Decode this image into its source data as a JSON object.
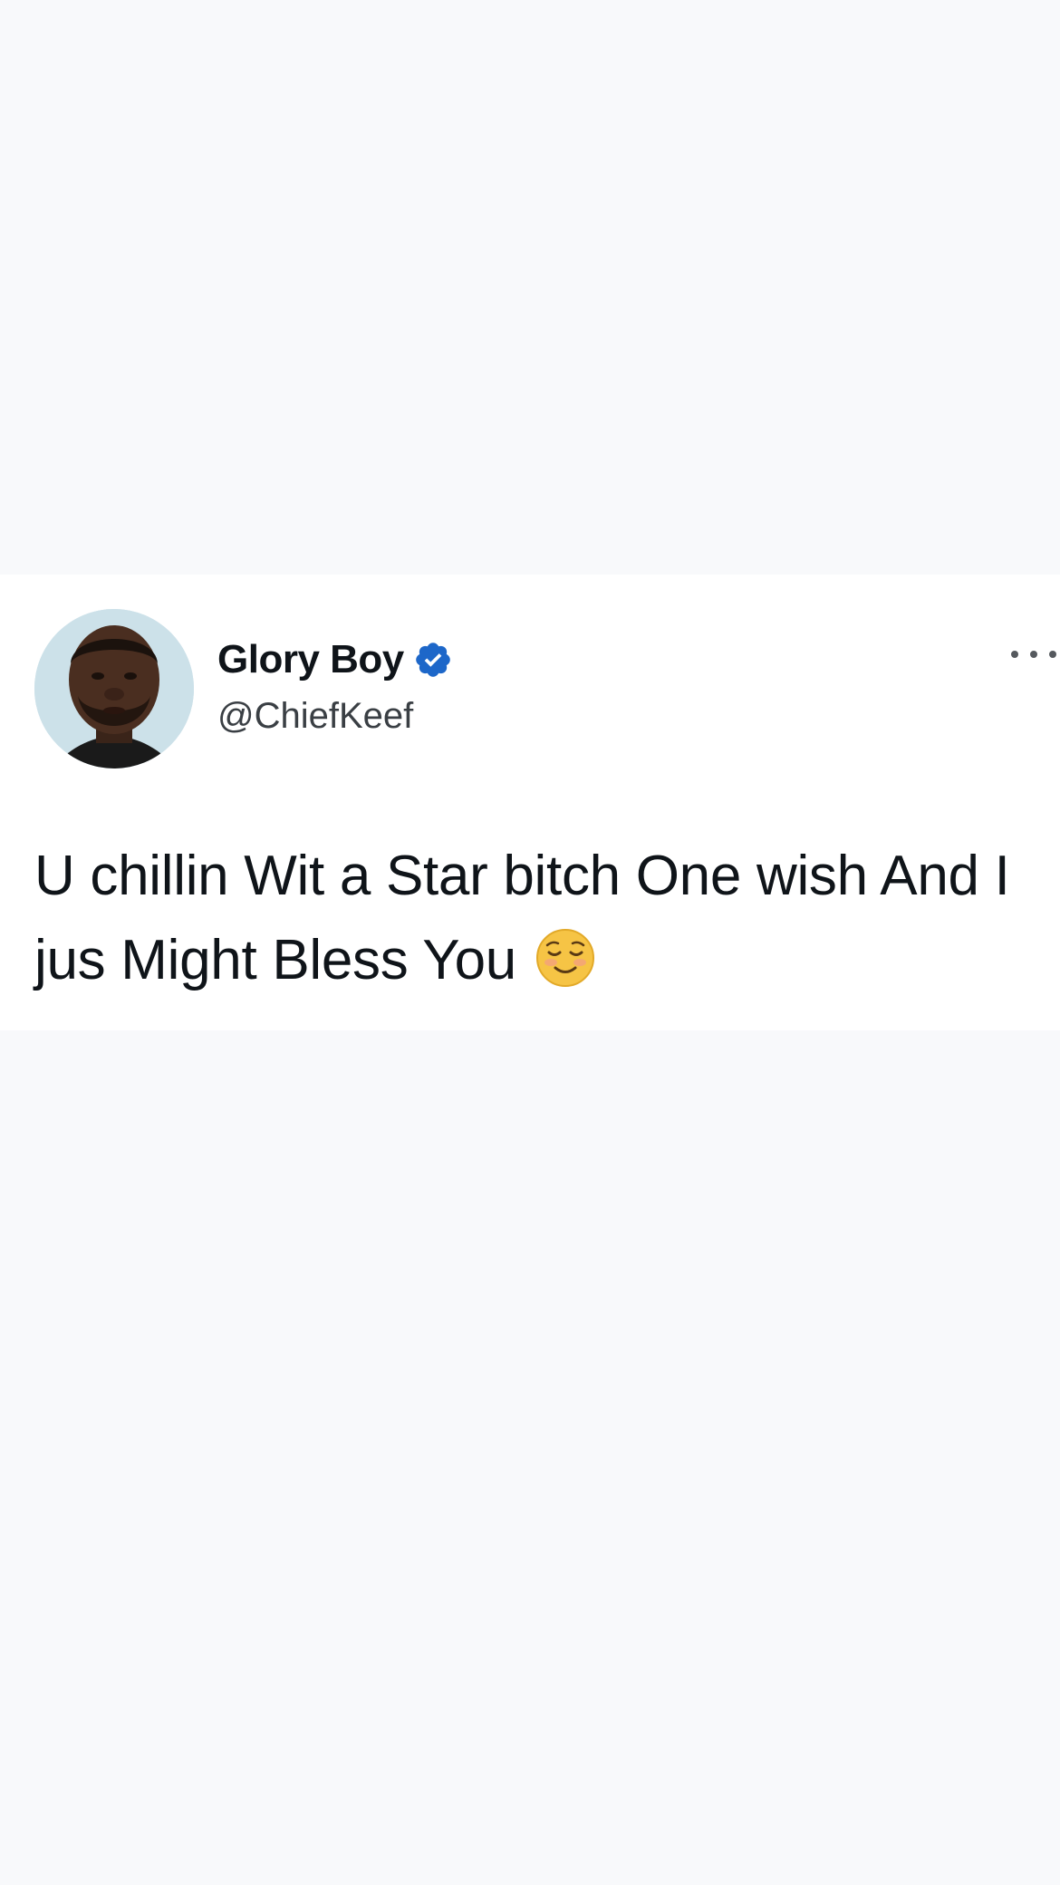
{
  "tweet": {
    "display_name": "Glory Boy",
    "handle": "@ChiefKeef",
    "text": "U chillin Wit a Star bitch One wish And I jus Might Bless You",
    "emoji": "smiling-face-with-blush-icon"
  },
  "icons": {
    "verified": "verified-badge-icon",
    "more": "more-options-icon",
    "avatar": "avatar"
  },
  "colors": {
    "verified_badge": "#1d67c9",
    "page_background": "#f8f9fb",
    "card_background": "#ffffff",
    "text_primary": "#0f1419"
  }
}
